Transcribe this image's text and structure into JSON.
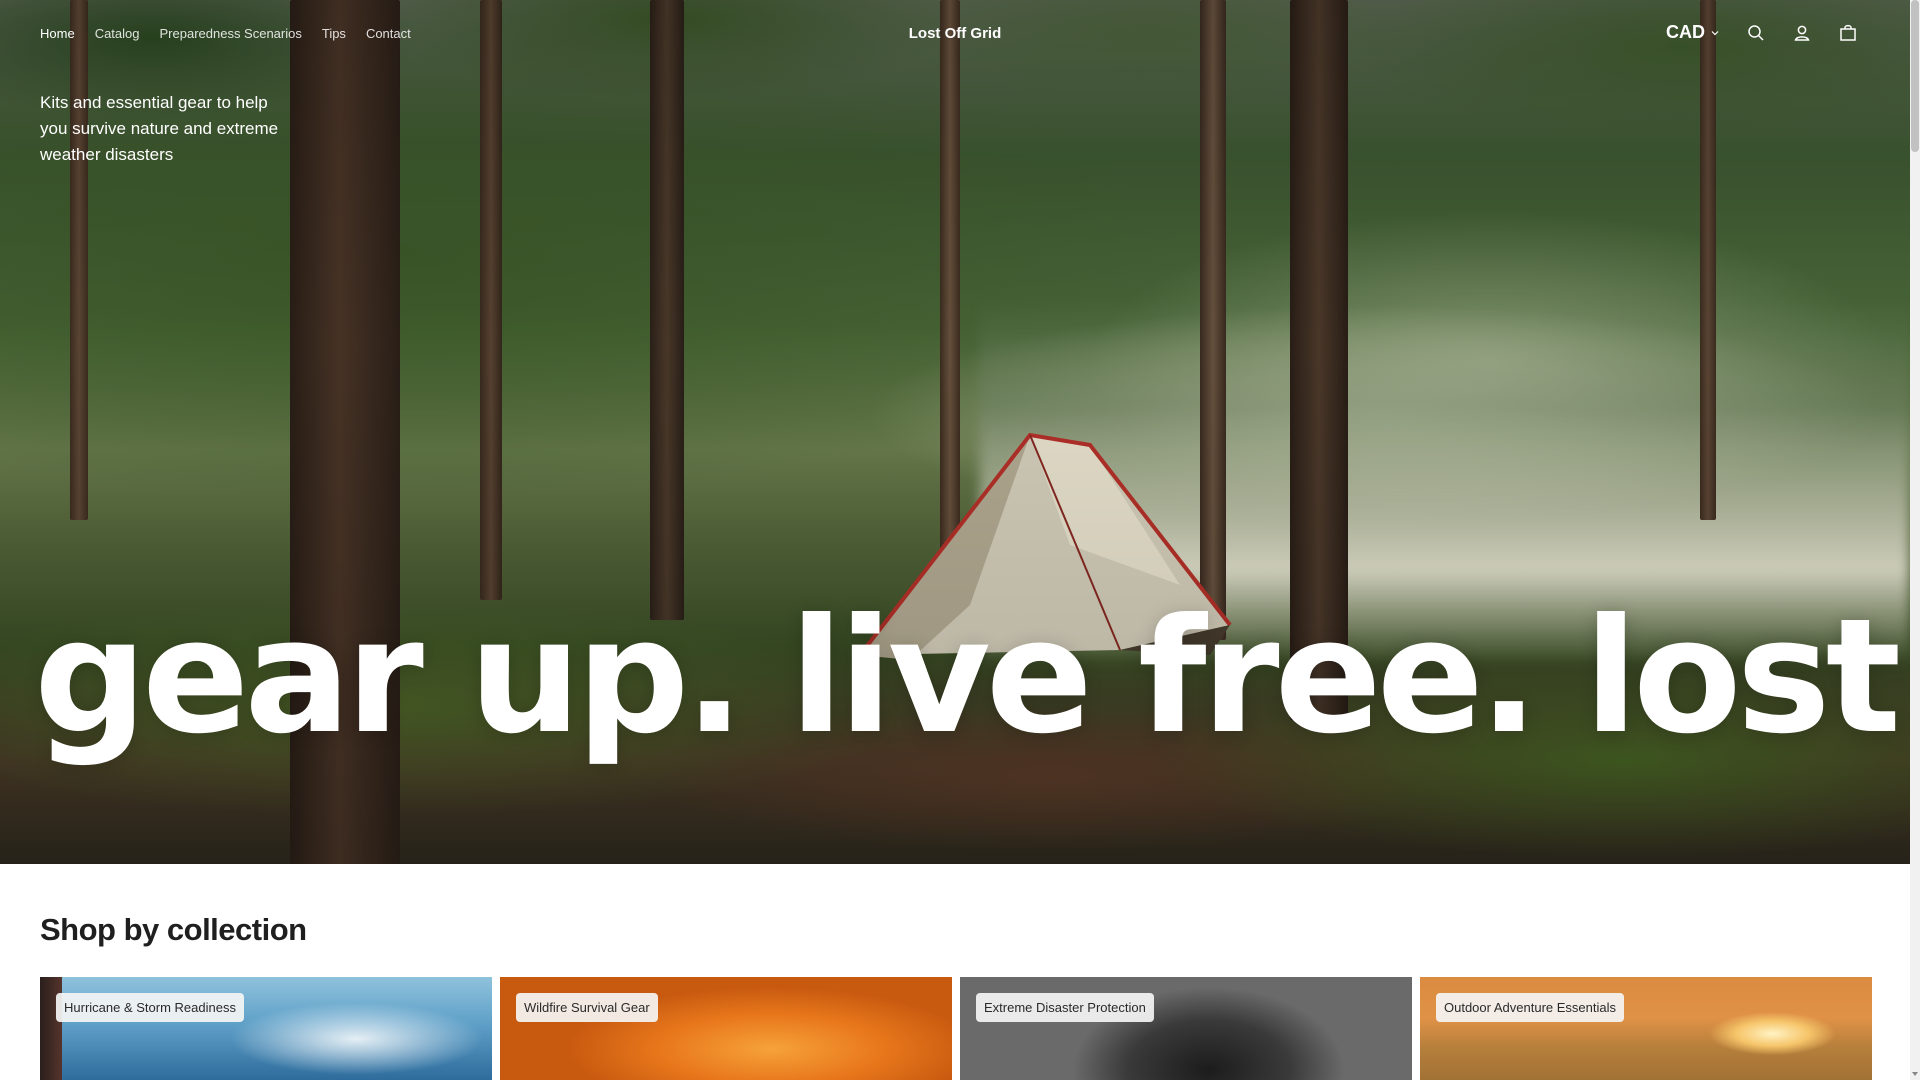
{
  "nav": {
    "items": [
      {
        "label": "Home",
        "active": true
      },
      {
        "label": "Catalog",
        "active": false
      },
      {
        "label": "Preparedness Scenarios",
        "active": false
      },
      {
        "label": "Tips",
        "active": false
      },
      {
        "label": "Contact",
        "active": false
      }
    ]
  },
  "brand": {
    "name": "Lost Off Grid"
  },
  "header": {
    "currency": "CAD",
    "icons": [
      "search-icon",
      "account-icon",
      "cart-icon",
      "chevron-down-icon"
    ]
  },
  "hero": {
    "tagline": "Kits and essential gear to help you survive nature and extreme weather disasters",
    "headline": "gear up. live free. lost off grid."
  },
  "collections": {
    "title": "Shop by collection",
    "items": [
      {
        "label": "Hurricane & Storm Readiness"
      },
      {
        "label": "Wildfire Survival Gear"
      },
      {
        "label": "Extreme Disaster Protection"
      },
      {
        "label": "Outdoor Adventure Essentials"
      }
    ]
  }
}
